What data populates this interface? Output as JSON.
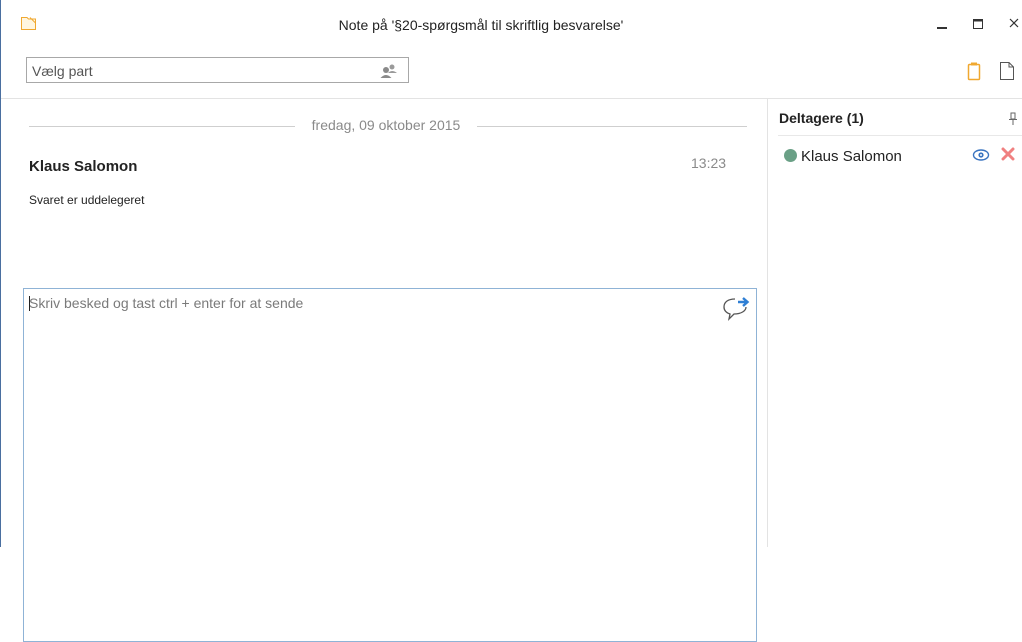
{
  "window": {
    "title": "Note på '§20-spørgsmål til skriftlig besvarelse'",
    "controls": [
      "minimize-icon",
      "maximize-icon",
      "close-icon"
    ]
  },
  "toolbar": {
    "party_placeholder": "Vælg part",
    "icons": [
      "people-icon",
      "clipboard-icon",
      "page-icon"
    ]
  },
  "chat": {
    "date": "fredag, 09 oktober 2015",
    "messages": [
      {
        "author": "Klaus Salomon",
        "time": "13:23",
        "text": "Svaret er uddelegeret"
      }
    ],
    "composer_placeholder": "Skriv besked og tast ctrl + enter for at sende"
  },
  "participants": {
    "header": "Deltagere (1)",
    "items": [
      {
        "name": "Klaus Salomon",
        "status_color": "#6aa086"
      }
    ]
  },
  "colors": {
    "accent_orange": "#f0a830",
    "send_blue": "#2f7fd4",
    "remove_red": "#f08080"
  }
}
